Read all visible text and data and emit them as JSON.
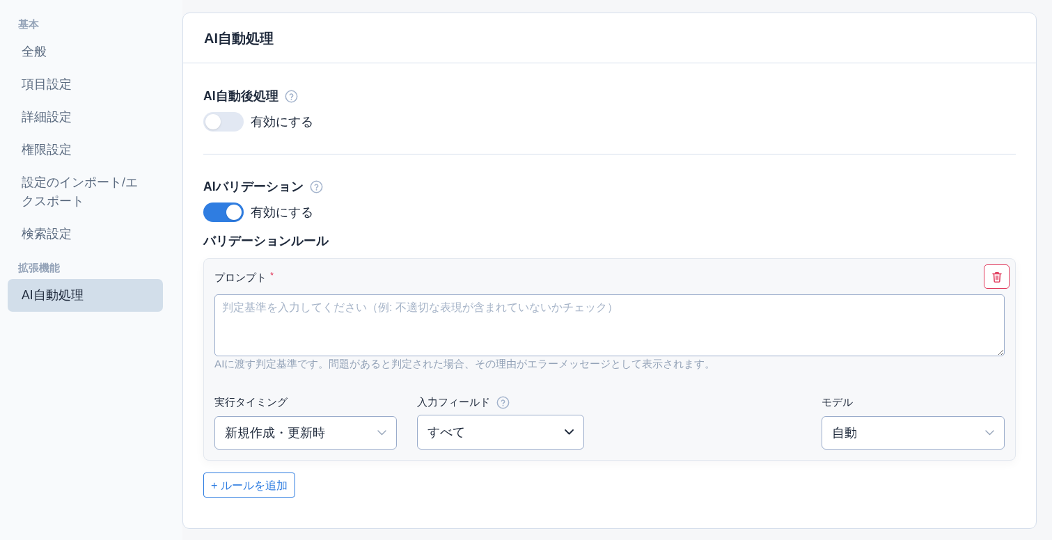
{
  "sidebar": {
    "sections": [
      {
        "title": "基本",
        "items": [
          {
            "label": "全般",
            "selected": false
          },
          {
            "label": "項目設定",
            "selected": false
          },
          {
            "label": "詳細設定",
            "selected": false
          },
          {
            "label": "権限設定",
            "selected": false
          },
          {
            "label": "設定のインポート/エクスポート",
            "selected": false
          },
          {
            "label": "検索設定",
            "selected": false
          }
        ]
      },
      {
        "title": "拡張機能",
        "items": [
          {
            "label": "AI自動処理",
            "selected": true
          }
        ]
      }
    ]
  },
  "panel": {
    "title": "AI自動処理",
    "settings": [
      {
        "label": "AI自動後処理",
        "has_help": true,
        "toggle": {
          "label": "有効にする",
          "on": false
        }
      },
      {
        "label": "AIバリデーション",
        "has_help": true,
        "toggle": {
          "label": "有効にする",
          "on": true
        }
      }
    ],
    "rules_section": {
      "title": "バリデーションルール",
      "rules": [
        {
          "prompt": {
            "label": "プロンプト",
            "required_mark": "*",
            "placeholder": "判定基準を入力してください（例: 不適切な表現が含まれていないかチェック）",
            "help": "AIに渡す判定基準です。問題があると判定された場合、その理由がエラーメッセージとして表示されます。"
          },
          "fields": [
            {
              "label": "実行タイミング",
              "has_help": false,
              "kind": "custom",
              "value": "新規作成・更新時"
            },
            {
              "label": "入力フィールド",
              "has_help": true,
              "kind": "native",
              "value": "すべて"
            },
            {
              "label": "モデル",
              "has_help": false,
              "kind": "custom",
              "value": "自動"
            }
          ]
        }
      ],
      "add_button": "+ ルールを追加"
    }
  }
}
